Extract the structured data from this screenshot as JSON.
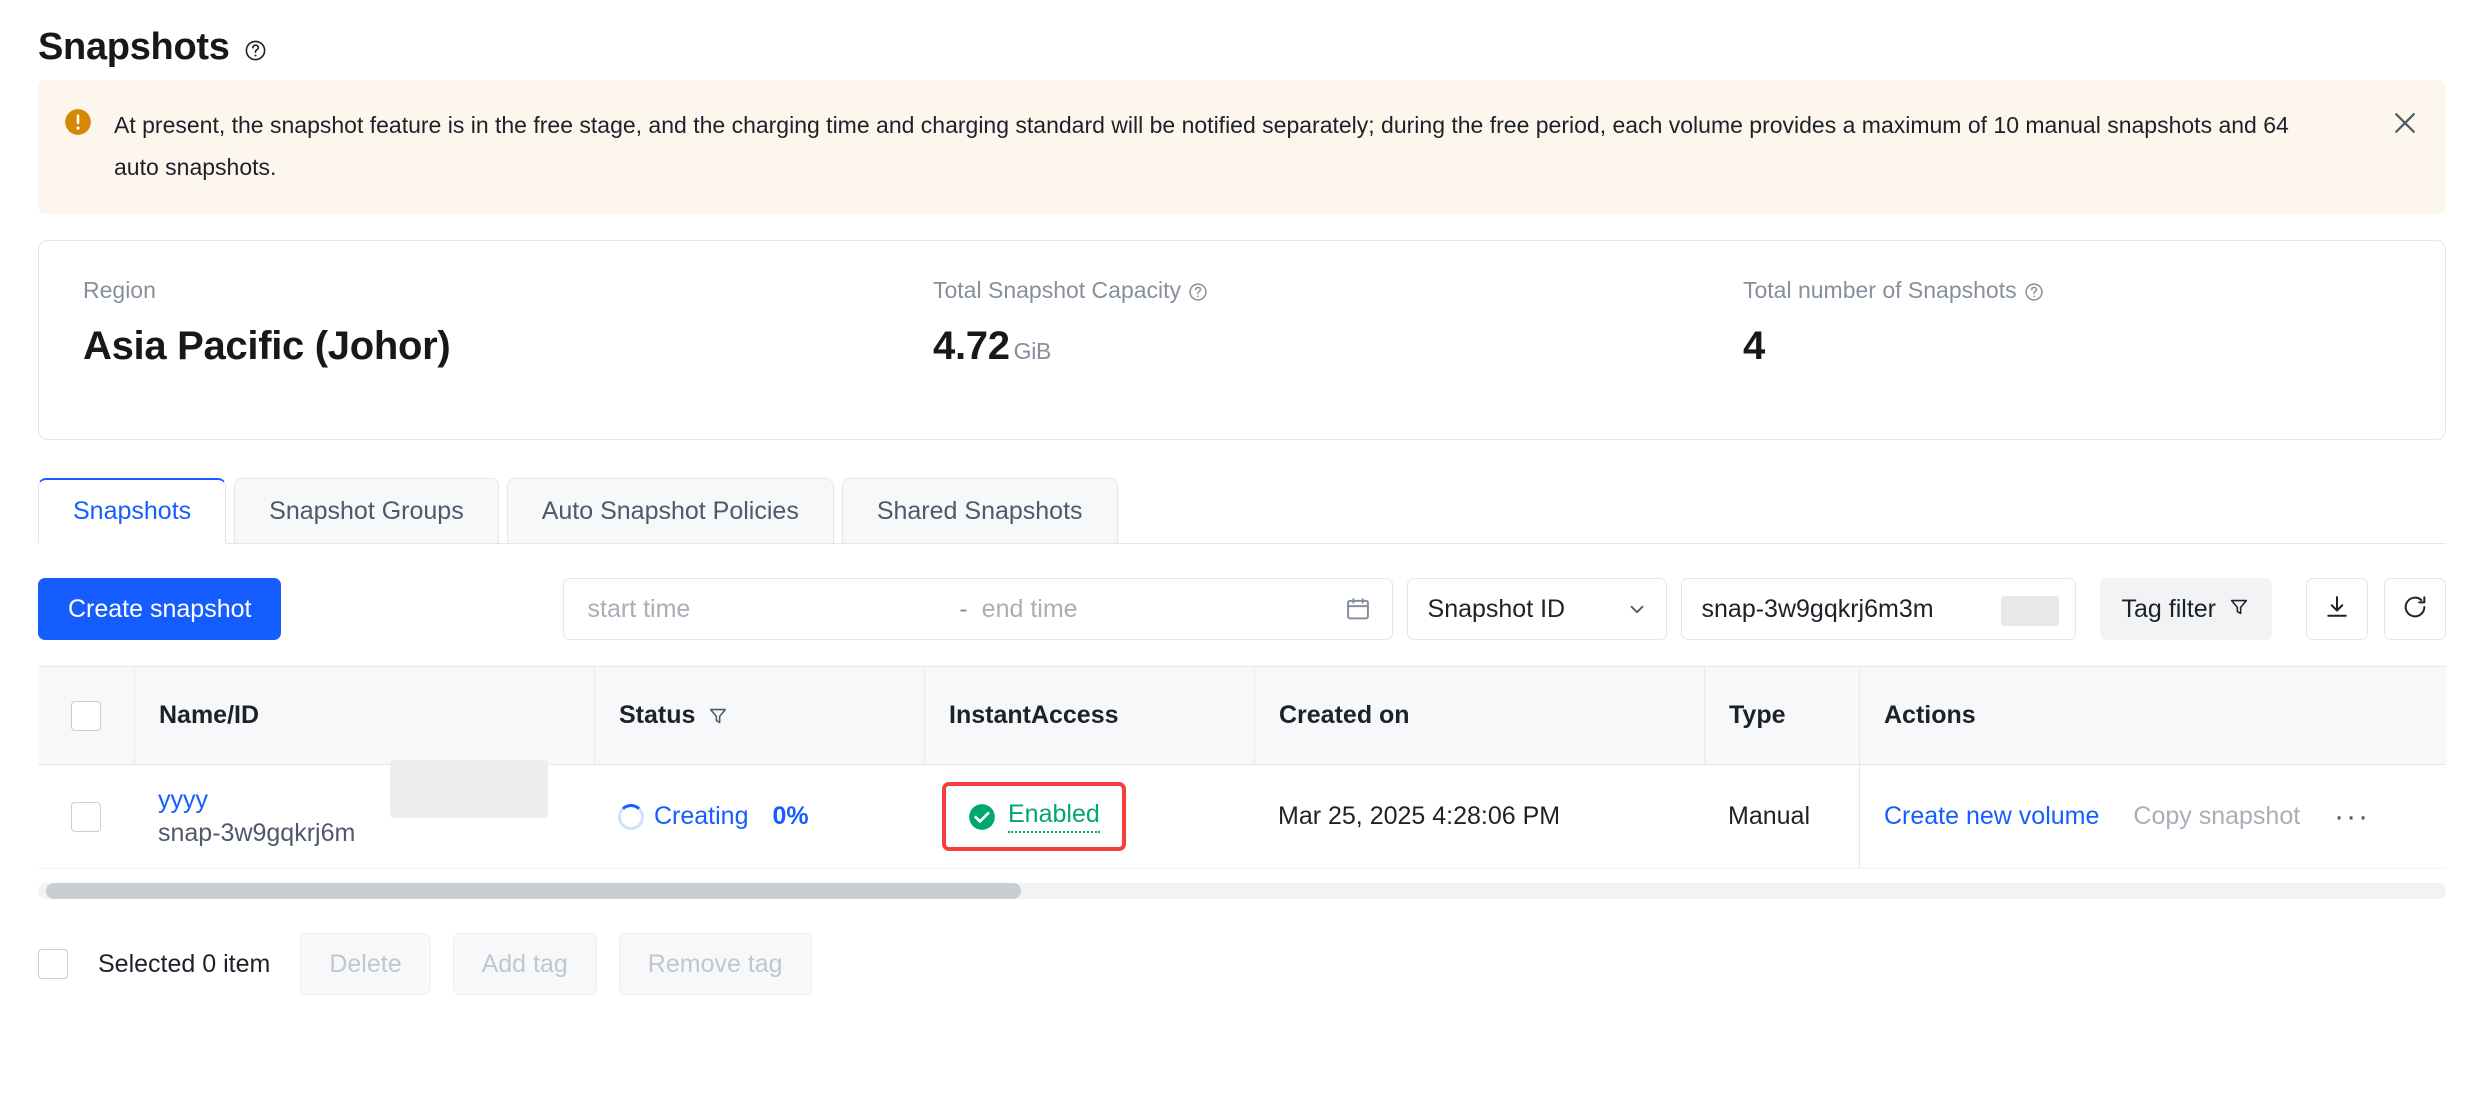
{
  "header": {
    "title": "Snapshots",
    "help_icon": "question-circle-icon"
  },
  "alert": {
    "icon": "warning-icon",
    "message": "At present, the snapshot feature is in the free stage, and the charging time and charging standard will be notified separately; during the free period, each volume provides a maximum of 10 manual snapshots and 64 auto snapshots.",
    "close_icon": "close-icon",
    "background_color": "#fdf6ec",
    "icon_color": "#d48806"
  },
  "stats": {
    "region": {
      "label": "Region",
      "value": "Asia Pacific (Johor)"
    },
    "capacity": {
      "label": "Total Snapshot Capacity",
      "value": "4.72",
      "unit": "GiB",
      "help_icon": "question-circle-icon"
    },
    "count": {
      "label": "Total number of Snapshots",
      "value": "4",
      "help_icon": "question-circle-icon"
    }
  },
  "tabs": [
    {
      "label": "Snapshots",
      "active": true
    },
    {
      "label": "Snapshot Groups",
      "active": false
    },
    {
      "label": "Auto Snapshot Policies",
      "active": false
    },
    {
      "label": "Shared Snapshots",
      "active": false
    }
  ],
  "toolbar": {
    "create_button": "Create snapshot",
    "start_time_placeholder": "start time",
    "end_time_placeholder": "end time",
    "range_separator": "-",
    "calendar_icon": "calendar-icon",
    "filter_select": {
      "value": "Snapshot ID",
      "chevron_icon": "chevron-down-icon"
    },
    "search_value": "snap-3w9gqkrj6m3m",
    "search_placeholder": "",
    "tag_filter": {
      "label": "Tag filter",
      "icon": "funnel-icon"
    },
    "download_icon": "download-icon",
    "refresh_icon": "refresh-icon"
  },
  "table": {
    "columns": [
      {
        "label": "Name/ID",
        "filter_icon": ""
      },
      {
        "label": "Status",
        "filter_icon": "funnel-icon"
      },
      {
        "label": "InstantAccess",
        "filter_icon": ""
      },
      {
        "label": "Created on",
        "filter_icon": ""
      },
      {
        "label": "Type",
        "filter_icon": ""
      },
      {
        "label": "Actions",
        "filter_icon": ""
      }
    ],
    "rows": [
      {
        "name": "yyyy",
        "id": "snap-3w9gqkrj6m",
        "status_icon": "spinner-icon",
        "status": "Creating",
        "progress": "0%",
        "instant_access_icon": "check-circle-icon",
        "instant_access": "Enabled",
        "instant_access_highlight_color": "#f53f3f",
        "created_on": "Mar 25, 2025 4:28:06 PM",
        "type": "Manual",
        "actions": [
          {
            "label": "Create new volume",
            "disabled": false
          },
          {
            "label": "Copy snapshot",
            "disabled": true
          }
        ],
        "more_actions": "···"
      }
    ]
  },
  "footer": {
    "selected_label": "Selected 0 item",
    "buttons": [
      {
        "label": "Delete",
        "disabled": true
      },
      {
        "label": "Add tag",
        "disabled": true
      },
      {
        "label": "Remove tag",
        "disabled": true
      }
    ]
  },
  "colors": {
    "primary": "#165dff",
    "success": "#00a870",
    "danger": "#f53f3f",
    "warning": "#d48806"
  }
}
